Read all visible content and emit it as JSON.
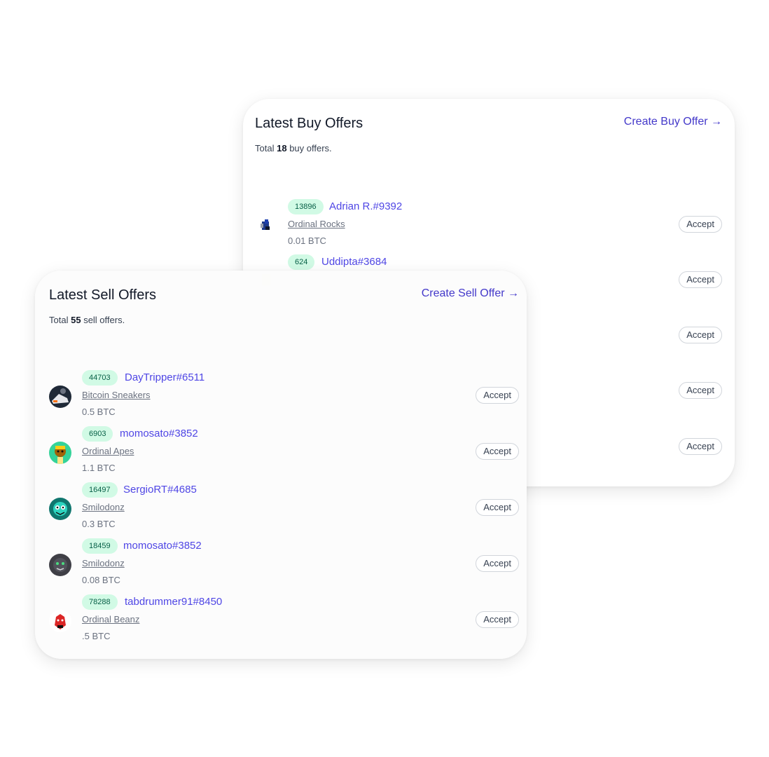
{
  "buy": {
    "title": "Latest Buy Offers",
    "action": "Create Buy Offer →",
    "total_prefix": "Total",
    "total_count": "18",
    "total_suffix": "buy offers.",
    "offers": [
      {
        "badge": "13896",
        "user": "Adrian R.#9392",
        "collection": "Ordinal Rocks",
        "price": "0.01 BTC",
        "accept": "Accept"
      },
      {
        "badge": "624",
        "user": "Uddipta#3684",
        "collection": "",
        "price": "",
        "accept": "Accept"
      },
      {
        "badge": "",
        "user": "",
        "collection": "",
        "price": "",
        "accept": "Accept"
      },
      {
        "badge": "",
        "user": "",
        "collection": "",
        "price": "",
        "accept": "Accept"
      },
      {
        "badge": "",
        "user": "",
        "collection": "",
        "price": "",
        "accept": "Accept"
      }
    ]
  },
  "sell": {
    "title": "Latest Sell Offers",
    "action": "Create Sell Offer →",
    "total_prefix": "Total",
    "total_count": "55",
    "total_suffix": "sell offers.",
    "offers": [
      {
        "badge": "44703",
        "user": "DayTripper#6511",
        "collection": "Bitcoin Sneakers",
        "price": "0.5 BTC",
        "accept": "Accept"
      },
      {
        "badge": "6903",
        "user": "momosato#3852",
        "collection": "Ordinal Apes",
        "price": "1.1 BTC",
        "accept": "Accept"
      },
      {
        "badge": "16497",
        "user": "SergioRT#4685",
        "collection": "Smilodonz",
        "price": "0.3 BTC",
        "accept": "Accept"
      },
      {
        "badge": "18459",
        "user": "momosato#3852",
        "collection": "Smilodonz",
        "price": "0.08 BTC",
        "accept": "Accept"
      },
      {
        "badge": "78288",
        "user": "tabdrummer91#8450",
        "collection": "Ordinal Beanz",
        "price": ".5 BTC",
        "accept": "Accept"
      }
    ]
  },
  "colors": {
    "accent": "#4f46e5",
    "badge_bg": "#d1fae5",
    "badge_text": "#065f46"
  }
}
